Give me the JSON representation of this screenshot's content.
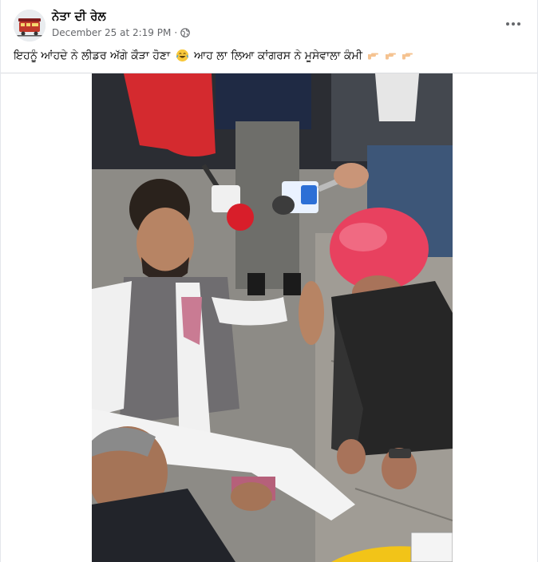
{
  "post": {
    "page_name": "ਨੇਤਾ ਦੀ ਰੇਲ",
    "timestamp": "December 25 at 2:19 PM",
    "separator": "·",
    "privacy_icon": "globe-icon",
    "more_icon": "more-options-icon",
    "caption_part1": "ਇਹਨੂੰ ਆਂਹਦੇ ਨੇ ਲੀਡਰ ਅੱਗੇ ਕੌੜਾ ਹੋਣਾ",
    "caption_emoji1": "laughing-face-emoji",
    "caption_part2": "ਆਹ ਲਾ ਲਿਆ ਕਾਂਗਰਸ ਨੇ ਮੂਸੇਵਾਲਾ ਕੰਮੀ",
    "caption_emoji2": "pointing-hands-emoji"
  },
  "media": {
    "type": "photo",
    "mic_labels": [
      "",
      ""
    ]
  },
  "colors": {
    "text_primary": "#050505",
    "text_secondary": "#65676b",
    "divider": "#dadde1",
    "turban": "#e8415f"
  }
}
